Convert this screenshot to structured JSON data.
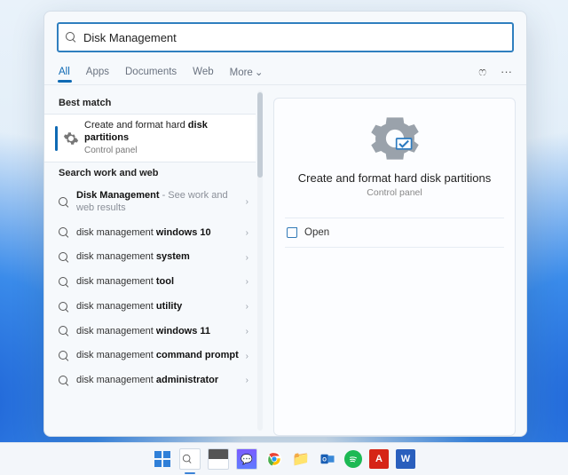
{
  "search": {
    "value": "Disk Management"
  },
  "tabs": {
    "all": "All",
    "apps": "Apps",
    "documents": "Documents",
    "web": "Web",
    "more": "More"
  },
  "left": {
    "best_match_header": "Best match",
    "best_match": {
      "line1_pre": "Create and format hard ",
      "line1_bold": "disk",
      "line2_bold": "partitions",
      "sub": "Control panel"
    },
    "search_sub_header": "Search work and web",
    "suggestions": [
      {
        "pre": "",
        "bold": "Disk Management",
        "post": "",
        "hint": " - See work and web results"
      },
      {
        "pre": "disk management ",
        "bold": "windows 10",
        "post": "",
        "hint": ""
      },
      {
        "pre": "disk management ",
        "bold": "system",
        "post": "",
        "hint": ""
      },
      {
        "pre": "disk management ",
        "bold": "tool",
        "post": "",
        "hint": ""
      },
      {
        "pre": "disk management ",
        "bold": "utility",
        "post": "",
        "hint": ""
      },
      {
        "pre": "disk management ",
        "bold": "windows 11",
        "post": "",
        "hint": ""
      },
      {
        "pre": "disk management ",
        "bold": "command prompt",
        "post": "",
        "hint": ""
      },
      {
        "pre": "disk management ",
        "bold": "administrator",
        "post": "",
        "hint": ""
      }
    ]
  },
  "detail": {
    "title": "Create and format hard disk partitions",
    "sub": "Control panel",
    "open": "Open"
  },
  "colors": {
    "accent": "#0f6ab4"
  }
}
